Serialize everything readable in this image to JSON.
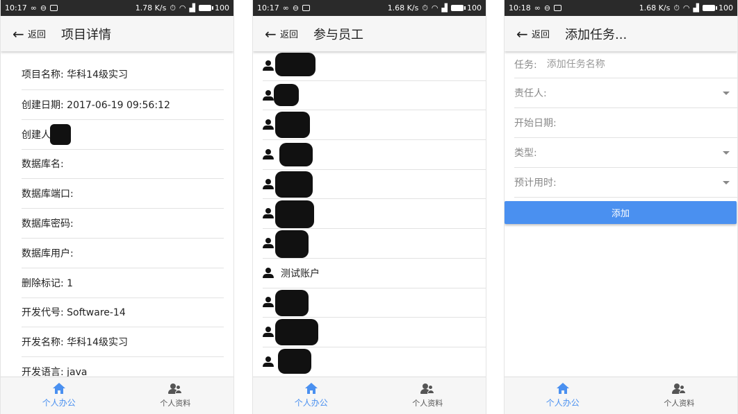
{
  "screens": [
    {
      "status": {
        "time": "10:17",
        "speed": "1.78 K/s",
        "battery": "100"
      },
      "header": {
        "back_label": "返回",
        "title": "项目详情"
      },
      "details": [
        "项目名称: 华科14级实习",
        "创建日期: 2017-06-19 09:56:12",
        "创建人:",
        "数据库名:",
        "数据库端口:",
        "数据库密码:",
        "数据库用户:",
        "删除标记: 1",
        "开发代号: Software-14",
        "开发名称: 华科14级实习",
        "开发语言: java"
      ]
    },
    {
      "status": {
        "time": "10:17",
        "speed": "1.68 K/s",
        "battery": "100"
      },
      "header": {
        "back_label": "返回",
        "title": "参与员工"
      },
      "employees": [
        "",
        "",
        "",
        "",
        "",
        "",
        "",
        "测试账户",
        "",
        "",
        ""
      ]
    },
    {
      "status": {
        "time": "10:18",
        "speed": "1.68 K/s",
        "battery": "100"
      },
      "header": {
        "back_label": "返回",
        "title": "添加任务..."
      },
      "form": {
        "task_label": "任务:",
        "task_placeholder": "添加任务名称",
        "owner_label": "责任人:",
        "start_label": "开始日期:",
        "type_label": "类型:",
        "duration_label": "预计用时:",
        "submit_label": "添加"
      }
    }
  ],
  "bottom_nav": {
    "office_label": "个人办公",
    "profile_label": "个人资料"
  },
  "colors": {
    "accent": "#4a90f0",
    "statusbar": "#2a2a2a",
    "appbar": "#f6f6f6"
  },
  "icons": [
    "back-arrow-icon",
    "person-icon",
    "home-icon",
    "profile-icon",
    "chevron-down-icon"
  ]
}
